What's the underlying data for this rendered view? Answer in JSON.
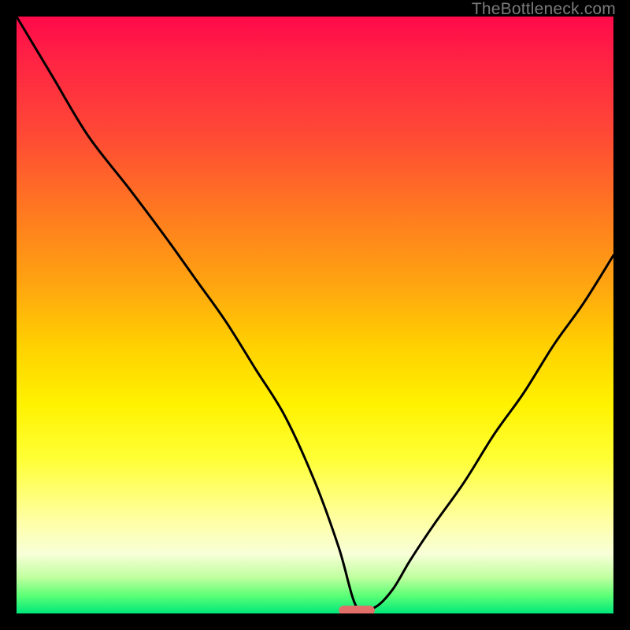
{
  "watermark": {
    "text": "TheBottleneck.com"
  },
  "chart_data": {
    "type": "line",
    "title": "",
    "xlabel": "",
    "ylabel": "",
    "xlim": [
      0,
      100
    ],
    "ylim": [
      0,
      100
    ],
    "grid": false,
    "legend": false,
    "notes": "Bottleneck-style curve: starts at 100% at x=0, decreases to ~0 near x≈57, then rises to ~60 at x=100. Background is a vertical color gradient from red (high) to green (low). A small red marker sits at the minimum.",
    "series": [
      {
        "name": "bottleneck",
        "x": [
          0,
          6,
          12,
          19,
          25,
          30,
          35,
          40,
          45,
          50,
          54,
          57,
          60,
          63,
          66,
          70,
          75,
          80,
          85,
          90,
          95,
          100
        ],
        "values": [
          100,
          90,
          80,
          71,
          63,
          56,
          49,
          41,
          33,
          22,
          11,
          1,
          1,
          4,
          9,
          15,
          22,
          30,
          37,
          45,
          52,
          60
        ]
      }
    ],
    "marker": {
      "x_center": 57,
      "y": 0.5,
      "width_units": 6,
      "height_units": 1.6,
      "color": "#e36f6a"
    },
    "gradient_stops": [
      {
        "pos": 0,
        "color": "#ff0a4a"
      },
      {
        "pos": 20,
        "color": "#ff4a35"
      },
      {
        "pos": 45,
        "color": "#ffa510"
      },
      {
        "pos": 65,
        "color": "#fff200"
      },
      {
        "pos": 84,
        "color": "#ffffa0"
      },
      {
        "pos": 94,
        "color": "#beff9e"
      },
      {
        "pos": 100,
        "color": "#00e87a"
      }
    ]
  }
}
